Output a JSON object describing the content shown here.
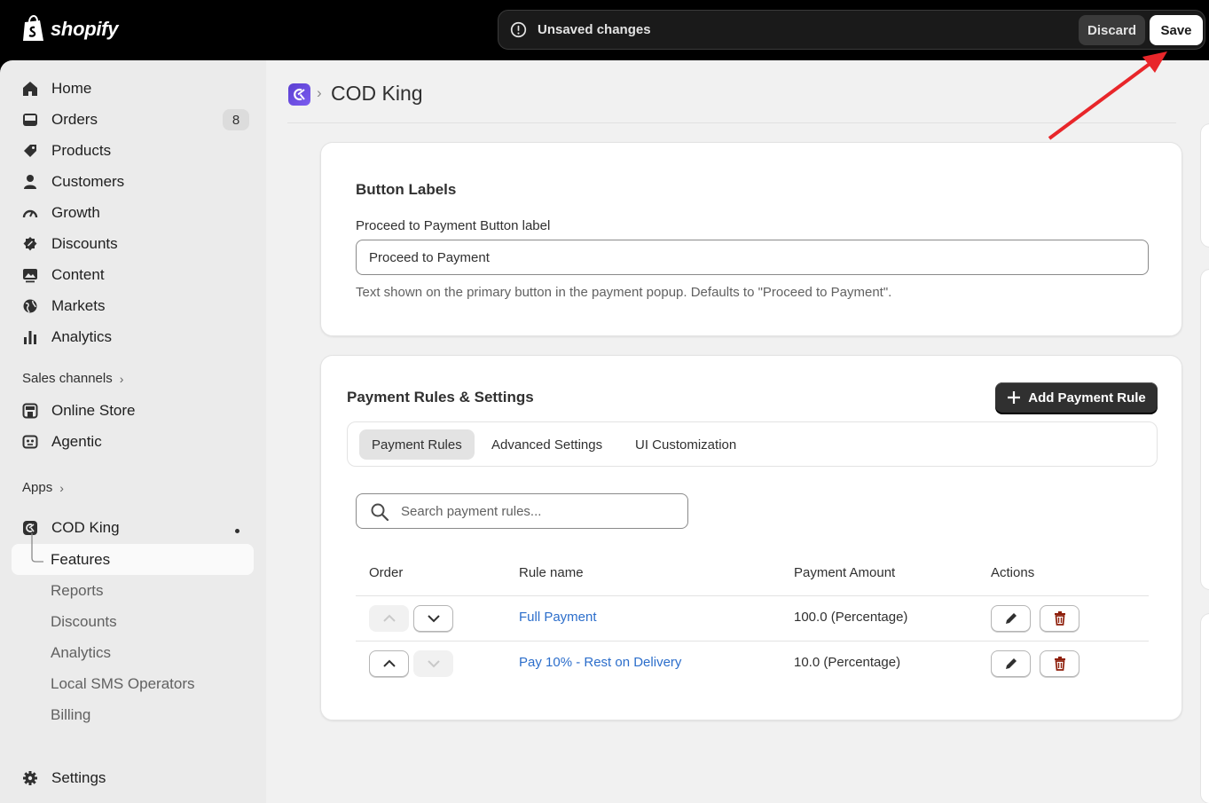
{
  "topbar": {
    "brand": "shopify",
    "unsaved_text": "Unsaved changes",
    "discard_label": "Discard",
    "save_label": "Save"
  },
  "sidebar": {
    "main_items": [
      {
        "label": "Home",
        "icon": "home-icon"
      },
      {
        "label": "Orders",
        "icon": "orders-icon",
        "badge": "8"
      },
      {
        "label": "Products",
        "icon": "tag-icon"
      },
      {
        "label": "Customers",
        "icon": "person-icon"
      },
      {
        "label": "Growth",
        "icon": "gauge-icon"
      },
      {
        "label": "Discounts",
        "icon": "discount-icon"
      },
      {
        "label": "Content",
        "icon": "image-icon"
      },
      {
        "label": "Markets",
        "icon": "globe-icon"
      },
      {
        "label": "Analytics",
        "icon": "bar-chart-icon"
      }
    ],
    "sales_channels_label": "Sales channels",
    "channels": [
      {
        "label": "Online Store",
        "icon": "store-icon"
      },
      {
        "label": "Agentic",
        "icon": "agentic-icon"
      }
    ],
    "apps_label": "Apps",
    "app_name": "COD King",
    "app_subitems": [
      "Features",
      "Reports",
      "Discounts",
      "Analytics",
      "Local SMS Operators",
      "Billing"
    ],
    "settings_label": "Settings"
  },
  "main": {
    "breadcrumb_separator": "›",
    "page_title": "COD King",
    "button_labels_card": {
      "title": "Button Labels",
      "field_label": "Proceed to Payment Button label",
      "field_value": "Proceed to Payment",
      "help_text": "Text shown on the primary button in the payment popup. Defaults to \"Proceed to Payment\"."
    },
    "payment_rules_card": {
      "title": "Payment Rules & Settings",
      "add_button_label": "Add Payment Rule",
      "tabs": [
        {
          "label": "Payment Rules",
          "active": true
        },
        {
          "label": "Advanced Settings",
          "active": false
        },
        {
          "label": "UI Customization",
          "active": false
        }
      ],
      "search_placeholder": "Search payment rules...",
      "columns": [
        "Order",
        "Rule name",
        "Payment Amount",
        "Actions"
      ],
      "rows": [
        {
          "rule_name": "Full Payment",
          "amount": "100.0 (Percentage)",
          "up_enabled": false,
          "down_enabled": true
        },
        {
          "rule_name": "Pay 10% - Rest on Delivery",
          "amount": "10.0 (Percentage)",
          "up_enabled": true,
          "down_enabled": false
        }
      ]
    }
  },
  "colors": {
    "accent_link": "#2c6ecb",
    "annotation_arrow": "#e8262a",
    "delete_icon": "#8e1f0b"
  }
}
